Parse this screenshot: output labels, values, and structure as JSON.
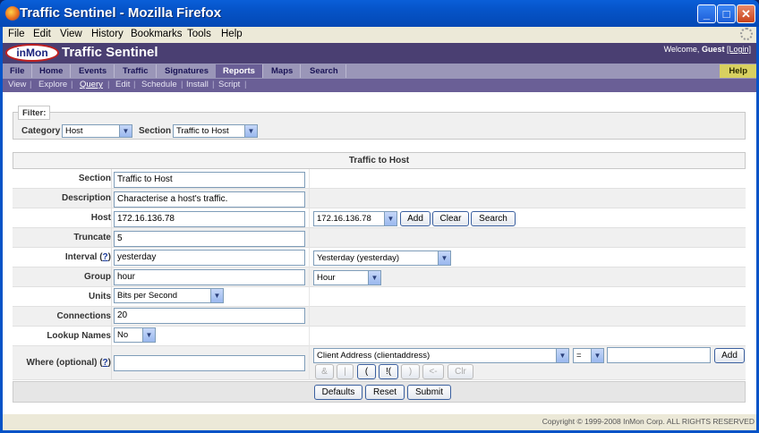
{
  "window": {
    "title": "Traffic Sentinel - Mozilla Firefox",
    "min_icon": "_",
    "max_icon": "□",
    "close_icon": "✕"
  },
  "menubar": [
    "File",
    "Edit",
    "View",
    "History",
    "Bookmarks",
    "Tools",
    "Help"
  ],
  "app": {
    "logo": "inMon",
    "title": "Traffic Sentinel",
    "welcome_prefix": "Welcome, ",
    "welcome_user": "Guest",
    "welcome_login": "[Login]"
  },
  "tabs": [
    "File",
    "Home",
    "Events",
    "Traffic",
    "Signatures",
    "Reports",
    "Maps",
    "Search"
  ],
  "active_tab": "Reports",
  "help_tab": "Help",
  "subnav": [
    "View",
    "Explore",
    "Query",
    "Edit",
    "Schedule",
    "Install",
    "Script"
  ],
  "active_subnav": "Query",
  "filter": {
    "legend": "Filter:",
    "category_label": "Category",
    "category_value": "Host",
    "section_label": "Section",
    "section_value": "Traffic to Host"
  },
  "form": {
    "heading": "Traffic to Host",
    "section_label": "Section",
    "section_value": "Traffic to Host",
    "description_label": "Description",
    "description_value": "Characterise a host's traffic.",
    "host_label": "Host",
    "host_value": "172.16.136.78",
    "host_select": "172.16.136.78",
    "host_add": "Add",
    "host_clear": "Clear",
    "host_search": "Search",
    "truncate_label": "Truncate",
    "truncate_value": "5",
    "interval_label": "Interval",
    "interval_help": "?",
    "interval_value": "yesterday",
    "interval_select": "Yesterday (yesterday)",
    "group_label": "Group",
    "group_value": "hour",
    "group_select": "Hour",
    "units_label": "Units",
    "units_select": "Bits per Second",
    "connections_label": "Connections",
    "connections_value": "20",
    "lookup_label": "Lookup Names",
    "lookup_select": "No",
    "where_label": "Where (optional)",
    "where_help": "?",
    "where_value": "",
    "where_field_select": "Client Address (clientaddress)",
    "where_op_select": "=",
    "where_operand": "",
    "where_add": "Add",
    "where_buttons": [
      "&",
      "|",
      "(",
      "!(",
      ")",
      "<-",
      "Clr"
    ]
  },
  "actions": {
    "defaults": "Defaults",
    "reset": "Reset",
    "submit": "Submit"
  },
  "copyright": "Copyright © 1999-2008 InMon Corp. ALL RIGHTS RESERVED"
}
